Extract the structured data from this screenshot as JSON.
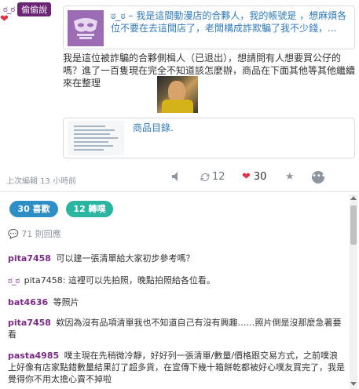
{
  "post": {
    "author": "ಠ_ಠ",
    "badge": "偷偷說",
    "quote_text": "ಠ_ಠ – 我是這間動漫店的合夥人，我的帳號是 ，想麻煩各位不要在去這間店了，老闆構成詐欺騙了我不少錢，...",
    "body": "我是這位被詐騙的合夥側楫人（已退出），想請問有人想要買公仔的嗎？進了一百隻現在完全不知道該怎麼辦，商品在下面其他等其他繼續來在整理",
    "link_title": "商品目錄.",
    "edited": "上次編輯 13 小時前",
    "repost_count": "12",
    "like_count": "30"
  },
  "stats": {
    "likes_label": "30 喜歡",
    "shares_label": "12 轉噗"
  },
  "comments_count": "71 則回應",
  "comments": [
    {
      "user": "pita7458",
      "text": "可以建一張清單給大家初步參考嗎？"
    },
    {
      "user": "ಠ_ಠ",
      "text": "pita7458: 這裡可以先拍照，晚點拍照給各位看。"
    },
    {
      "user": "bat4636",
      "text": "等照片"
    },
    {
      "user": "pita7458",
      "text": "欸因為沒有品項清單我也不知道自己有沒有興趣……照片倒是沒那麼急著要看"
    },
    {
      "user": "pasta4985",
      "text": "噗主現在先稍微冷靜，好好列一張清單/數量/價格跟交易方式，之前噗浪上好像有店家點錯數量結果訂了超多貨，在宣傳下幾十箱餅乾都被好心噗友買完了，我是覺得你不用太擔心賣不掉啦"
    }
  ],
  "colors": {
    "brand_purple": "#6b2575",
    "link_blue": "#2f7ab8",
    "like_red": "#e0324b",
    "pill_blue": "#2e8fc7",
    "pill_teal": "#2ab5a0"
  },
  "icons": [
    "heart-icon",
    "mute-icon",
    "repost-icon",
    "like-heart-icon",
    "star-icon",
    "more-icon",
    "comment-icon"
  ]
}
